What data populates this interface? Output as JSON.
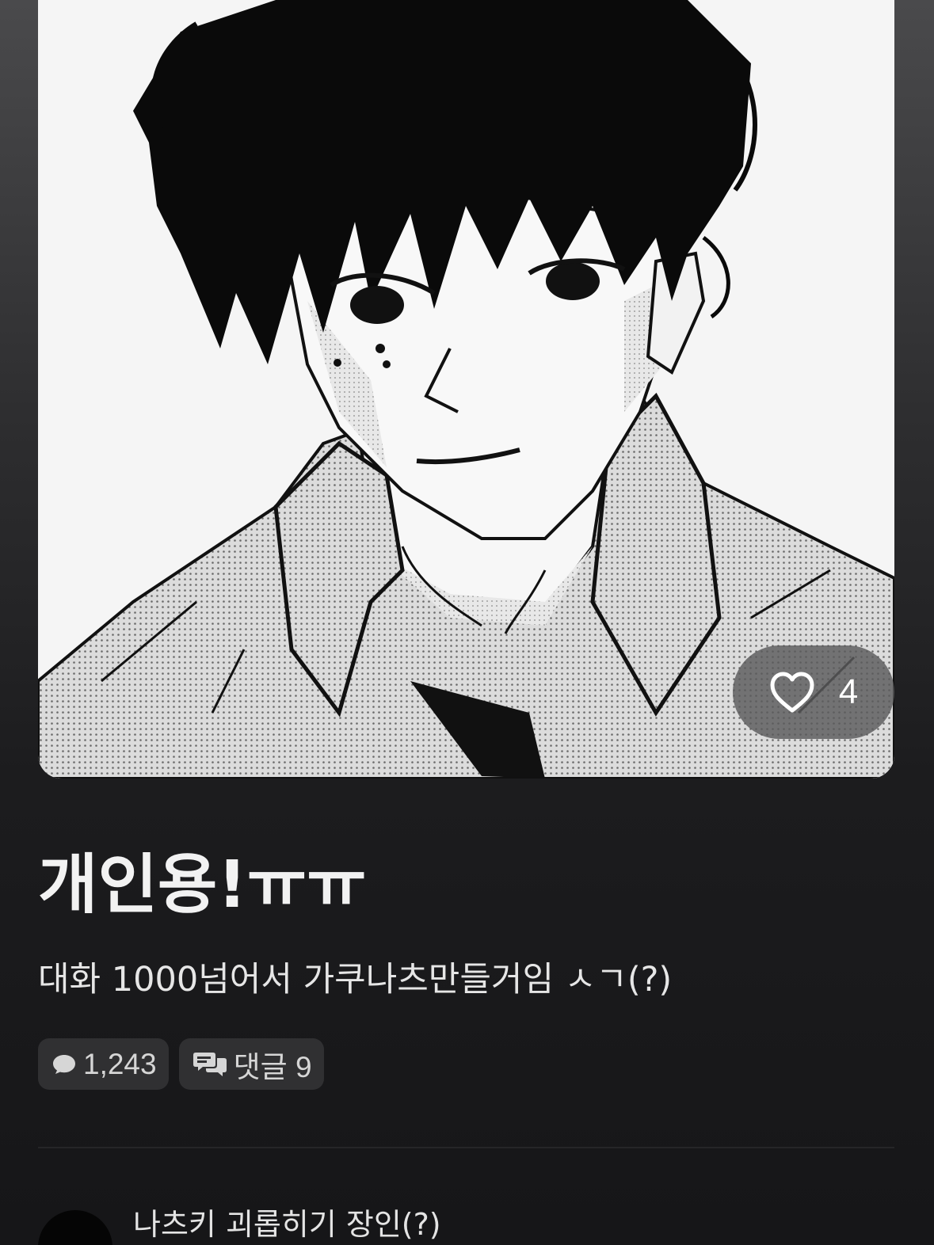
{
  "hero": {
    "image_alt": "manga-style black and white illustration of a dark-haired boy in a collared shirt",
    "like_icon": "heart-outline-icon",
    "like_count": "4"
  },
  "post": {
    "title": "개인용!ㅠㅠ",
    "subtitle": "대화 1000넘어서 가쿠나츠만들거임 ㅅㄱ(?)"
  },
  "stats": {
    "chat_icon": "chat-bubble-icon",
    "chat_count": "1,243",
    "comments_icon": "comments-icon",
    "comments_label": "댓글 9"
  },
  "author": {
    "name": "나츠키 괴롭히기 장인(?)"
  },
  "colors": {
    "background": "#161618",
    "chip": "#303032",
    "text": "#eeeeee",
    "like_pill": "#5a5a5c"
  }
}
